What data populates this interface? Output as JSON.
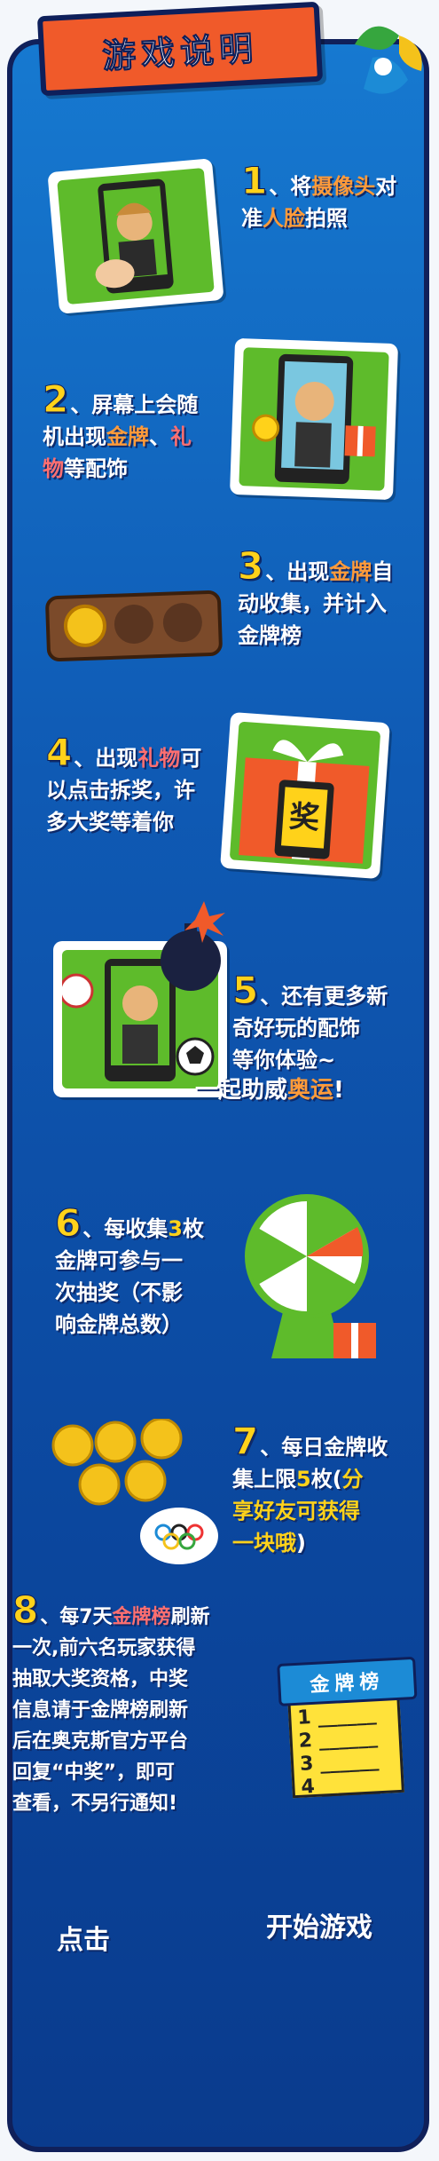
{
  "title": "游戏说明",
  "colors": {
    "panel_top": "#1679d0",
    "panel_bottom": "#0a3b8d",
    "accent_orange": "#f05a2a",
    "gold": "#ffd21a",
    "green": "#5ebb2b"
  },
  "steps": [
    {
      "num": "1",
      "parts": [
        "、将",
        "摄像头",
        "对",
        "准",
        "人脸",
        "拍照"
      ]
    },
    {
      "num": "2",
      "parts": [
        "、屏幕上会随",
        "机出现",
        "金牌",
        "、",
        "礼",
        "物",
        "等配饰"
      ]
    },
    {
      "num": "3",
      "parts": [
        "、出现",
        "金牌",
        "自",
        "动收集，并计入",
        "金牌榜"
      ]
    },
    {
      "num": "4",
      "parts": [
        "、出现",
        "礼物",
        "可",
        "以点击拆奖，许",
        "多大奖等着你"
      ]
    },
    {
      "num": "5",
      "parts": [
        "、还有更多新",
        "奇好玩的配饰",
        "等你体验~"
      ]
    },
    {
      "num": "6",
      "parts": [
        "、每收集",
        "3",
        "枚",
        "金牌可参与一",
        "次抽奖（不影",
        "响金牌总数）"
      ]
    },
    {
      "num": "7",
      "parts": [
        "、每日金牌收",
        "集上限",
        "5",
        "枚(",
        "分",
        "享好友可获得",
        "一块哦",
        ")"
      ]
    },
    {
      "num": "8",
      "parts": [
        "、每7天",
        "金牌榜",
        "刷新",
        "一次,前六名玩家获得",
        "抽取大奖资格，中奖",
        "信息请于金牌榜刷新",
        "后在奥克斯官方平台",
        "回复“中奖”，即可",
        "查看，不另行通知!"
      ]
    }
  ],
  "cheer": {
    "pre": "一起助威",
    "mid": "奥运",
    "post": "!"
  },
  "rank_card": {
    "title": "金牌榜",
    "rows": [
      "1",
      "2",
      "3",
      "4"
    ]
  },
  "gift_text": "奖",
  "buttons": {
    "click": "点击",
    "start": "开始游戏"
  }
}
